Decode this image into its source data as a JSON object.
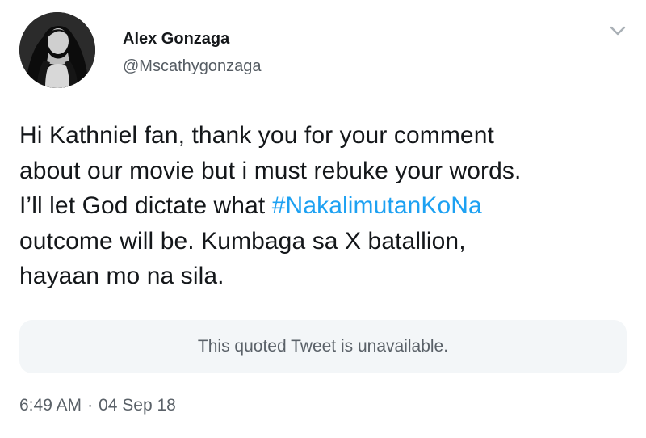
{
  "tweet": {
    "author": {
      "display_name": "Alex Gonzaga",
      "handle": "@Mscathygonzaga",
      "avatar_icon": "profile-photo"
    },
    "menu_icon": "chevron-down-icon",
    "text": {
      "line1": "Hi Kathniel fan, thank you for your comment",
      "line2": "about our movie but i must rebuke your words.",
      "line3_prefix": "I’ll let God dictate what ",
      "hashtag": "#NakalimutanKoNa",
      "line4": "outcome will be. Kumbaga sa X batallion,",
      "line5": "hayaan mo na sila."
    },
    "quoted_tweet": {
      "message": "This quoted Tweet is unavailable."
    },
    "time": "6:49 AM",
    "separator": "·",
    "date": "04 Sep 18"
  },
  "colors": {
    "link": "#1da1f2",
    "text": "#14171a",
    "muted": "#5a6168",
    "quote_background": "#f3f6f8"
  }
}
